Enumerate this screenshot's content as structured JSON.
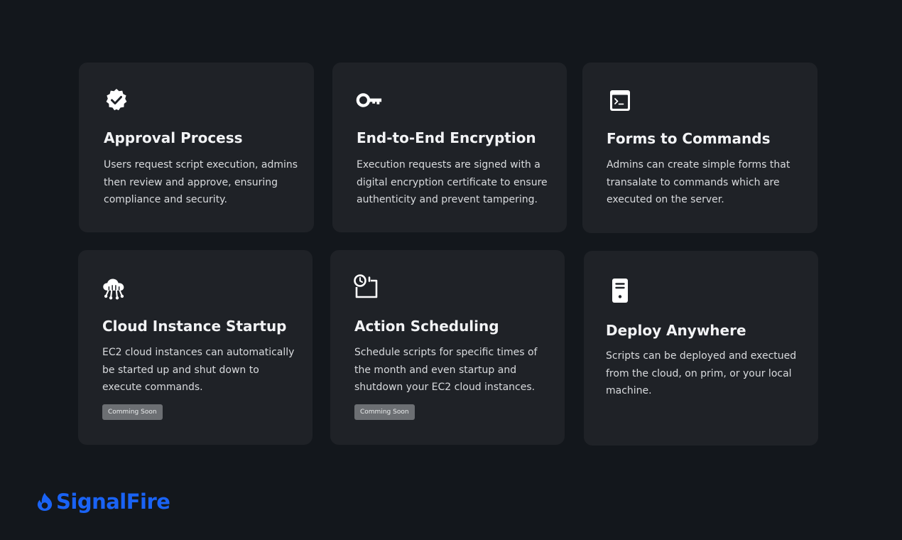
{
  "features": [
    {
      "icon": "verified-badge-icon",
      "title": "Approval Process",
      "description": "Users request script execution, admins then review and approve, ensuring compliance and security."
    },
    {
      "icon": "key-icon",
      "title": "End-to-End Encryption",
      "description": "Execution requests are signed with a digital encryption certificate to ensure authenticity and prevent tampering."
    },
    {
      "icon": "terminal-icon",
      "title": "Forms to Commands",
      "description": "Admins can create simple forms that transalate to commands which are executed on the server."
    },
    {
      "icon": "cloud-network-icon",
      "title": "Cloud Instance Startup",
      "description": "EC2 cloud instances can automatically be started up and shut down to execute commands.",
      "badge": "Comming Soon"
    },
    {
      "icon": "clock-calendar-icon",
      "title": "Action Scheduling",
      "description": "Schedule scripts for specific times of the month and even startup and shutdown your EC2 cloud instances.",
      "badge": "Comming Soon"
    },
    {
      "icon": "server-device-icon",
      "title": "Deploy Anywhere",
      "description": "Scripts can be deployed and exectued from the cloud, on prim, or your local machine."
    }
  ],
  "brand": {
    "name": "SignalFire",
    "icon": "flame-icon",
    "color": "#1a63f5"
  },
  "colors": {
    "background": "#13171c",
    "card": "#1f2227",
    "badge": "#6c6f73"
  }
}
